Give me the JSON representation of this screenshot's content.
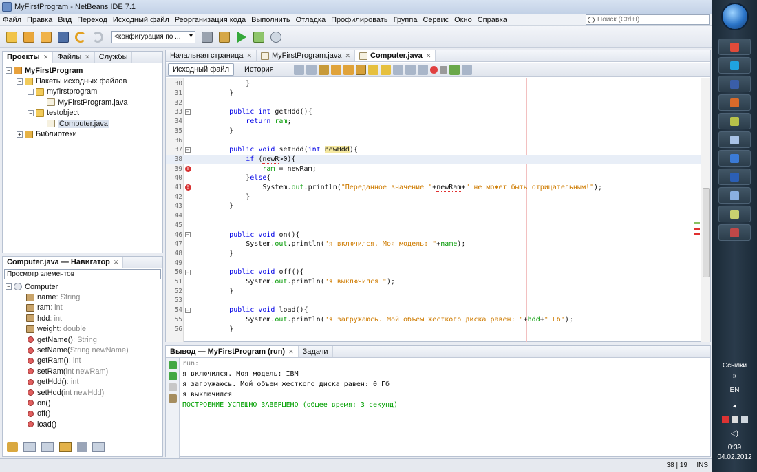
{
  "window": {
    "title": "MyFirstProgram - NetBeans IDE 7.1"
  },
  "menu": [
    "Файл",
    "Правка",
    "Вид",
    "Переход",
    "Исходный файл",
    "Реорганизация кода",
    "Выполнить",
    "Отладка",
    "Профилировать",
    "Группа",
    "Сервис",
    "Окно",
    "Справка"
  ],
  "search": {
    "placeholder": "Поиск (Ctrl+I)"
  },
  "toolbar": {
    "config": "<конфигурация по ..."
  },
  "projects": {
    "tabs": [
      "Проекты",
      "Файлы",
      "Службы"
    ],
    "tree": [
      {
        "label": "MyFirstProgram",
        "icon": "project-icon",
        "level": 0,
        "toggle": "−",
        "bold": true
      },
      {
        "label": "Пакеты исходных файлов",
        "icon": "package-folder-icon",
        "level": 1,
        "toggle": "−"
      },
      {
        "label": "myfirstprogram",
        "icon": "package-icon",
        "level": 2,
        "toggle": "−"
      },
      {
        "label": "MyFirstProgram.java",
        "icon": "java-file-icon",
        "level": 3,
        "toggle": ""
      },
      {
        "label": "testobject",
        "icon": "package-icon",
        "level": 2,
        "toggle": "−"
      },
      {
        "label": "Computer.java",
        "icon": "java-file-icon",
        "level": 3,
        "toggle": "",
        "selected": true
      },
      {
        "label": "Библиотеки",
        "icon": "library-icon",
        "level": 1,
        "toggle": "+"
      }
    ]
  },
  "navigator": {
    "title": "Computer.java — Навигатор",
    "filter": "Просмотр элементов",
    "root": "Computer",
    "members": [
      {
        "name": "name",
        "type": " : String",
        "kind": "field"
      },
      {
        "name": "ram",
        "type": " : int",
        "kind": "field"
      },
      {
        "name": "hdd",
        "type": " : int",
        "kind": "field"
      },
      {
        "name": "weight",
        "type": " : double",
        "kind": "field"
      },
      {
        "name": "getName()",
        "type": " : String",
        "kind": "method"
      },
      {
        "name": "setName(",
        "type": "String newName)",
        "kind": "method"
      },
      {
        "name": "getRam()",
        "type": " : int",
        "kind": "method"
      },
      {
        "name": "setRam(",
        "type": "int newRam)",
        "kind": "method"
      },
      {
        "name": "getHdd()",
        "type": " : int",
        "kind": "method"
      },
      {
        "name": "setHdd(",
        "type": "int newHdd)",
        "kind": "method"
      },
      {
        "name": "on()",
        "type": "",
        "kind": "method"
      },
      {
        "name": "off()",
        "type": "",
        "kind": "method"
      },
      {
        "name": "load()",
        "type": "",
        "kind": "method"
      }
    ]
  },
  "editor": {
    "tabs": [
      "Начальная страница",
      "MyFirstProgram.java",
      "Computer.java"
    ],
    "active_tab": 2,
    "source_button": "Исходный файл",
    "history_button": "История",
    "lines": [
      {
        "n": "30",
        "html": "            }"
      },
      {
        "n": "31",
        "html": "        }"
      },
      {
        "n": "32",
        "html": ""
      },
      {
        "n": "33",
        "html": "        <span class=\"kw\">public</span> <span class=\"kw\">int</span> getHdd(){",
        "fold": true
      },
      {
        "n": "34",
        "html": "            <span class=\"kw\">return</span> <span class=\"fd\">ram</span>;"
      },
      {
        "n": "35",
        "html": "        }"
      },
      {
        "n": "36",
        "html": ""
      },
      {
        "n": "37",
        "html": "        <span class=\"kw\">public</span> <span class=\"kw\">void</span> setHdd(<span class=\"kw\">int</span> <span class=\"hl\">newHdd</span>){",
        "fold": true
      },
      {
        "n": "38",
        "html": "            <span class=\"kw\">if</span> (<span class=\"ul\">newR</span>&gt;0){",
        "cur": true
      },
      {
        "n": "39",
        "html": "                <span class=\"fd\">ram</span> = <span class=\"ul\">newRam</span>;",
        "err": true
      },
      {
        "n": "40",
        "html": "            }<span class=\"kw\">else</span>{"
      },
      {
        "n": "41",
        "html": "                System.<span class=\"fd\">out</span>.println(<span class=\"st\">\"Переданное значение \"</span>+<span class=\"ul\">newRam</span>+<span class=\"st\">\" не может быть отрицательным!\"</span>);",
        "err": true
      },
      {
        "n": "42",
        "html": "            }"
      },
      {
        "n": "43",
        "html": "        }"
      },
      {
        "n": "44",
        "html": ""
      },
      {
        "n": "45",
        "html": ""
      },
      {
        "n": "46",
        "html": "        <span class=\"kw\">public</span> <span class=\"kw\">void</span> on(){",
        "fold": true
      },
      {
        "n": "47",
        "html": "            System.<span class=\"fd\">out</span>.println(<span class=\"st\">\"я включился. Моя модель: \"</span>+<span class=\"fd\">name</span>);"
      },
      {
        "n": "48",
        "html": "        }"
      },
      {
        "n": "49",
        "html": ""
      },
      {
        "n": "50",
        "html": "        <span class=\"kw\">public</span> <span class=\"kw\">void</span> off(){",
        "fold": true
      },
      {
        "n": "51",
        "html": "            System.<span class=\"fd\">out</span>.println(<span class=\"st\">\"я выключился \"</span>);"
      },
      {
        "n": "52",
        "html": "        }"
      },
      {
        "n": "53",
        "html": ""
      },
      {
        "n": "54",
        "html": "        <span class=\"kw\">public</span> <span class=\"kw\">void</span> load(){",
        "fold": true
      },
      {
        "n": "55",
        "html": "            System.<span class=\"fd\">out</span>.println(<span class=\"st\">\"я загружаюсь. Мой объем жесткого диска равен: \"</span>+<span class=\"fd\">hdd</span>+<span class=\"st\">\" Гб\"</span>);"
      },
      {
        "n": "56",
        "html": "        }"
      }
    ]
  },
  "output": {
    "tab": "Вывод — MyFirstProgram (run)",
    "tasks_tab": "Задачи",
    "lines": [
      {
        "text": "run:",
        "style": "run"
      },
      {
        "text": "я включился. Моя модель: IBM",
        "style": "normal"
      },
      {
        "text": "я загружаюсь. Мой объем жесткого диска равен: 0 Гб",
        "style": "normal"
      },
      {
        "text": "я выключился",
        "style": "normal"
      },
      {
        "text": "ПОСТРОЕНИЕ УСПЕШНО ЗАВЕРШЕНО (общее время: 3 секунд)",
        "style": "ok"
      }
    ]
  },
  "status": {
    "position": "38 | 19",
    "mode": "INS"
  },
  "taskbar": {
    "apps": [
      {
        "name": "chrome-icon",
        "color": "#e04b3a"
      },
      {
        "name": "skype-icon",
        "color": "#1fa3e0"
      },
      {
        "name": "save-icon",
        "color": "#3a5ea8"
      },
      {
        "name": "powerpoint-icon",
        "color": "#d86a2a"
      },
      {
        "name": "notepad-icon",
        "color": "#b8c24a"
      },
      {
        "name": "monitor-icon",
        "color": "#a9c3e6"
      },
      {
        "name": "paint-icon",
        "color": "#3b7bd6"
      },
      {
        "name": "word-icon",
        "color": "#2b5fb5"
      },
      {
        "name": "netbeans-icon",
        "color": "#8ab0e0"
      },
      {
        "name": "editor-icon",
        "color": "#c8d170"
      },
      {
        "name": "network-icon",
        "color": "#c04848"
      }
    ],
    "links_label": "Ссылки",
    "lang": "EN",
    "time": "0:39",
    "date": "04.02.2012"
  }
}
